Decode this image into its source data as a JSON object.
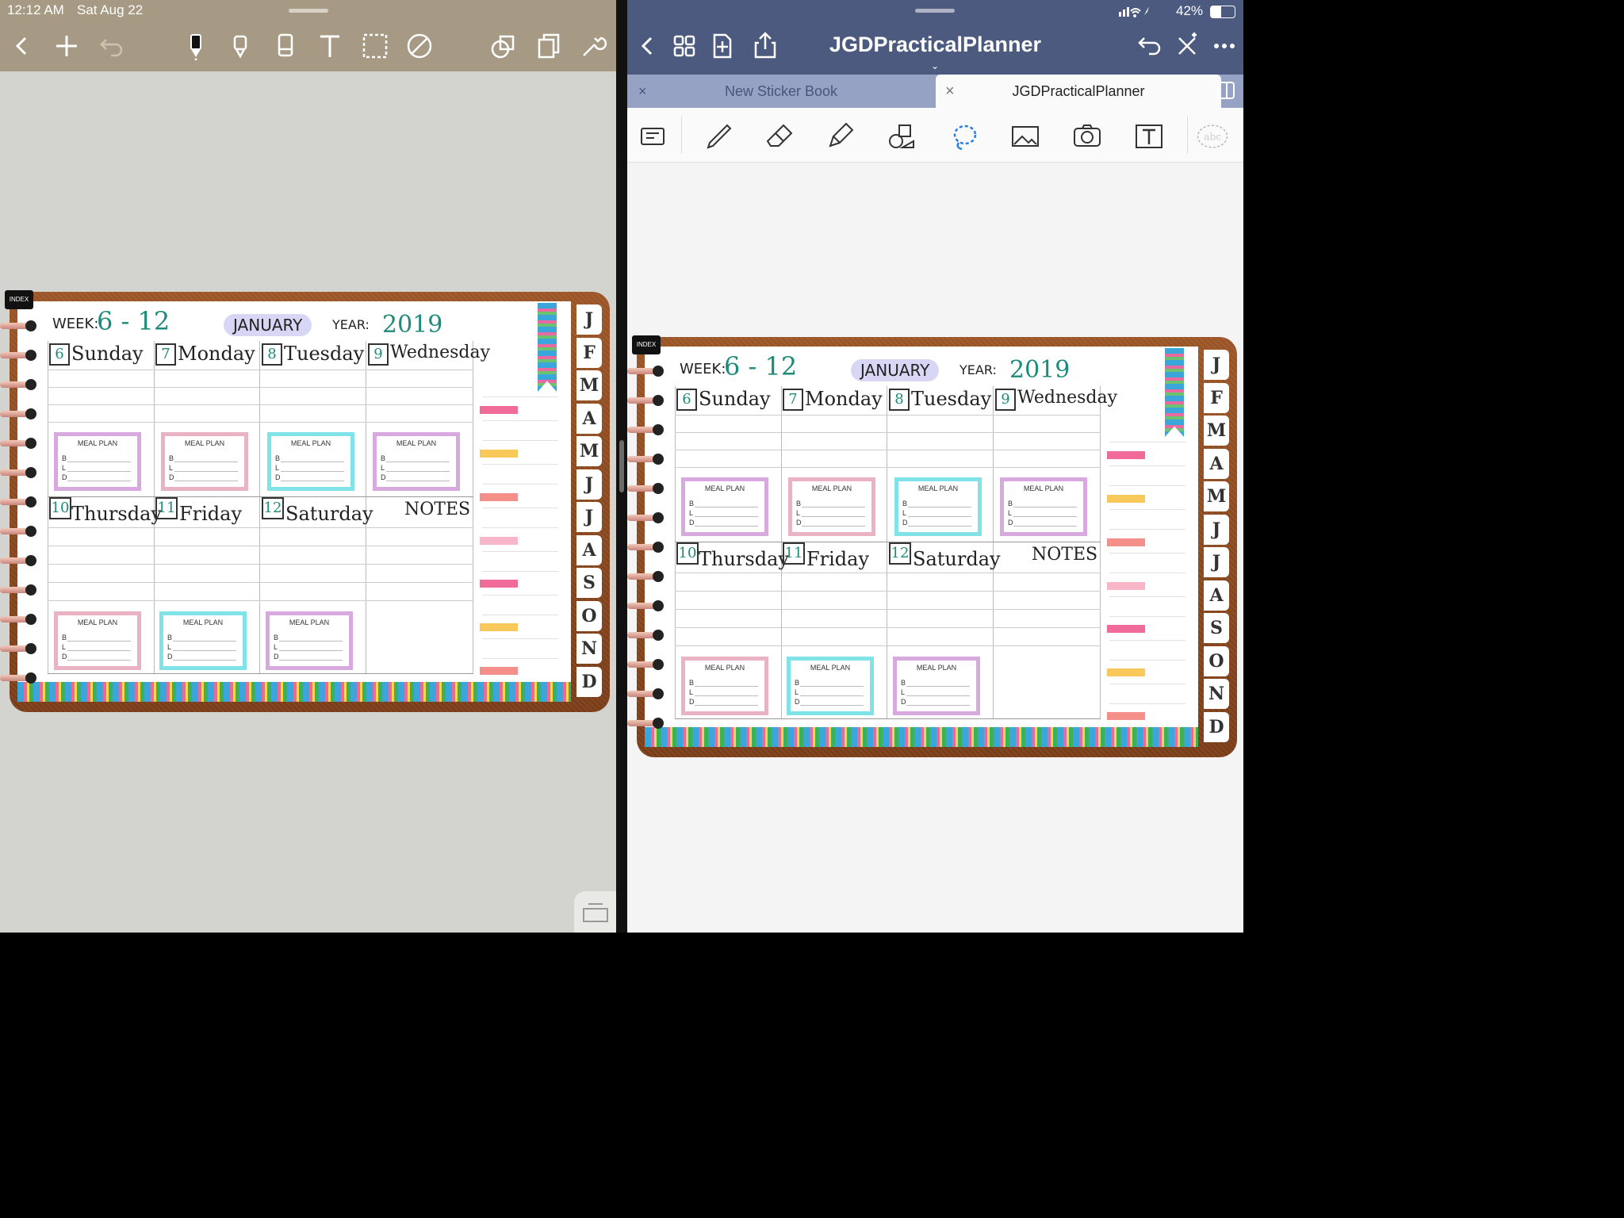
{
  "left_pane": {
    "status": {
      "time": "12:12 AM",
      "date": "Sat Aug 22"
    },
    "toolbar": {
      "left": [
        "back-icon",
        "plus-icon",
        "undo-icon"
      ],
      "center": [
        "pen-icon",
        "highlighter-icon",
        "eraser-icon",
        "text-icon",
        "lasso-icon",
        "no-drawing-icon"
      ],
      "right": [
        "shapes-icon",
        "pages-icon",
        "wrench-icon"
      ]
    }
  },
  "right_pane": {
    "status": {
      "battery": "42%"
    },
    "title": "JGDPracticalPlanner",
    "tabs": [
      {
        "label": "New Sticker Book",
        "active": false
      },
      {
        "label": "JGDPracticalPlanner",
        "active": true
      }
    ],
    "tools": [
      "keyboard-icon",
      "pen-icon",
      "eraser-icon",
      "highlighter-icon",
      "shapes-icon",
      "lasso-icon",
      "image-icon",
      "camera-icon",
      "text-box-icon",
      "handwriting-icon"
    ]
  },
  "planner": {
    "index_label": "INDEX",
    "week_label": "WEEK:",
    "week_value": "6 - 12",
    "month": "JANUARY",
    "year_label": "YEAR:",
    "year_value": "2019",
    "days_top": [
      {
        "num": "6",
        "name": "Sunday"
      },
      {
        "num": "7",
        "name": "Monday"
      },
      {
        "num": "8",
        "name": "Tuesday"
      },
      {
        "num": "9",
        "name": "Wednesday"
      }
    ],
    "days_bottom": [
      {
        "num": "10",
        "name": "Thursday"
      },
      {
        "num": "11",
        "name": "Friday"
      },
      {
        "num": "12",
        "name": "Saturday"
      }
    ],
    "notes_label": "NOTES",
    "meal_plan_label": "MEAL PLAN",
    "meal_letters": "B\nL\nD",
    "meal_colors_top": [
      "#d7a9de",
      "#eab3c3",
      "#7fe3e8",
      "#d7a9de"
    ],
    "meal_colors_bottom": [
      "#eab3c3",
      "#7fe3e8",
      "#d7a9de"
    ],
    "side_tab_colors": [
      "#f06a9a",
      "#f8c95a",
      "#f58f8a",
      "#f9b6c8",
      "#f06a9a",
      "#f8c95a",
      "#f58f8a"
    ],
    "months": [
      "J",
      "F",
      "M",
      "A",
      "M",
      "J",
      "J",
      "A",
      "S",
      "O",
      "N",
      "D"
    ]
  }
}
